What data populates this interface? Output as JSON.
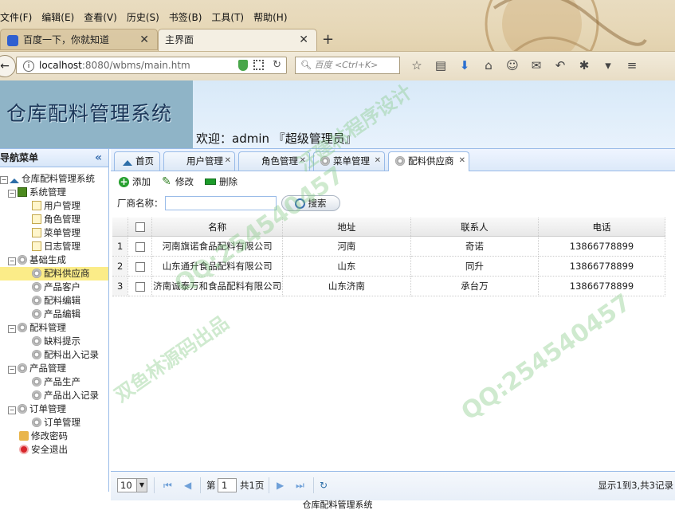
{
  "browser": {
    "menu": [
      "文件(F)",
      "编辑(E)",
      "查看(V)",
      "历史(S)",
      "书签(B)",
      "工具(T)",
      "帮助(H)"
    ],
    "tabs": [
      {
        "title": "百度一下，你就知道",
        "active": false
      },
      {
        "title": "主界面",
        "active": true
      }
    ],
    "url_host": "localhost",
    "url_path": ":8080/wbms/main.htm",
    "search_placeholder": "百度 <Ctrl+K>"
  },
  "header": {
    "logo_text": "仓库配料管理系统",
    "welcome": "欢迎：admin 『超级管理员』"
  },
  "sidebar": {
    "title": "导航菜单",
    "collapse": "«",
    "root": "仓库配料管理系统",
    "groups": [
      {
        "label": "系统管理",
        "items": [
          "用户管理",
          "角色管理",
          "菜单管理",
          "日志管理"
        ]
      },
      {
        "label": "基础生成",
        "items": [
          "配料供应商",
          "产品客户",
          "配料编辑",
          "产品编辑"
        ]
      },
      {
        "label": "配料管理",
        "items": [
          "缺料提示",
          "配料出入记录"
        ]
      },
      {
        "label": "产品管理",
        "items": [
          "产品生产",
          "产品出入记录"
        ]
      },
      {
        "label": "订单管理",
        "items": [
          "订单管理"
        ]
      }
    ],
    "extra": [
      "修改密码",
      "安全退出"
    ],
    "selected": "配料供应商"
  },
  "tabs": [
    {
      "label": "首页",
      "closable": false
    },
    {
      "label": "用户管理",
      "closable": true
    },
    {
      "label": "角色管理",
      "closable": true
    },
    {
      "label": "菜单管理",
      "closable": true
    },
    {
      "label": "配料供应商",
      "closable": true,
      "active": true
    }
  ],
  "toolbar": {
    "add": "添加",
    "edit": "修改",
    "delete": "删除"
  },
  "filter": {
    "label": "厂商名称：",
    "value": "",
    "search": "搜索"
  },
  "grid": {
    "columns": [
      "名称",
      "地址",
      "联系人",
      "电话"
    ],
    "rows": [
      {
        "n": "1",
        "name": "河南旗诺食品配料有限公司",
        "addr": "河南",
        "contact": "奇诺",
        "phone": "13866778899"
      },
      {
        "n": "2",
        "name": "山东通升食品配料有限公司",
        "addr": "山东",
        "contact": "同升",
        "phone": "13866778899"
      },
      {
        "n": "3",
        "name": "济南诚泰万和食品配料有限公司",
        "addr": "山东济南",
        "contact": "承台万",
        "phone": "13866778899"
      }
    ]
  },
  "pager": {
    "page_size": "10",
    "page_prefix": "第",
    "page": "1",
    "page_suffix": "共1页",
    "info": "显示1到3,共3记录"
  },
  "footer": "仓库配料管理系统",
  "watermark": [
    "QQ:254540457",
    "汪建林程序设计",
    "双鱼林源码出品"
  ]
}
